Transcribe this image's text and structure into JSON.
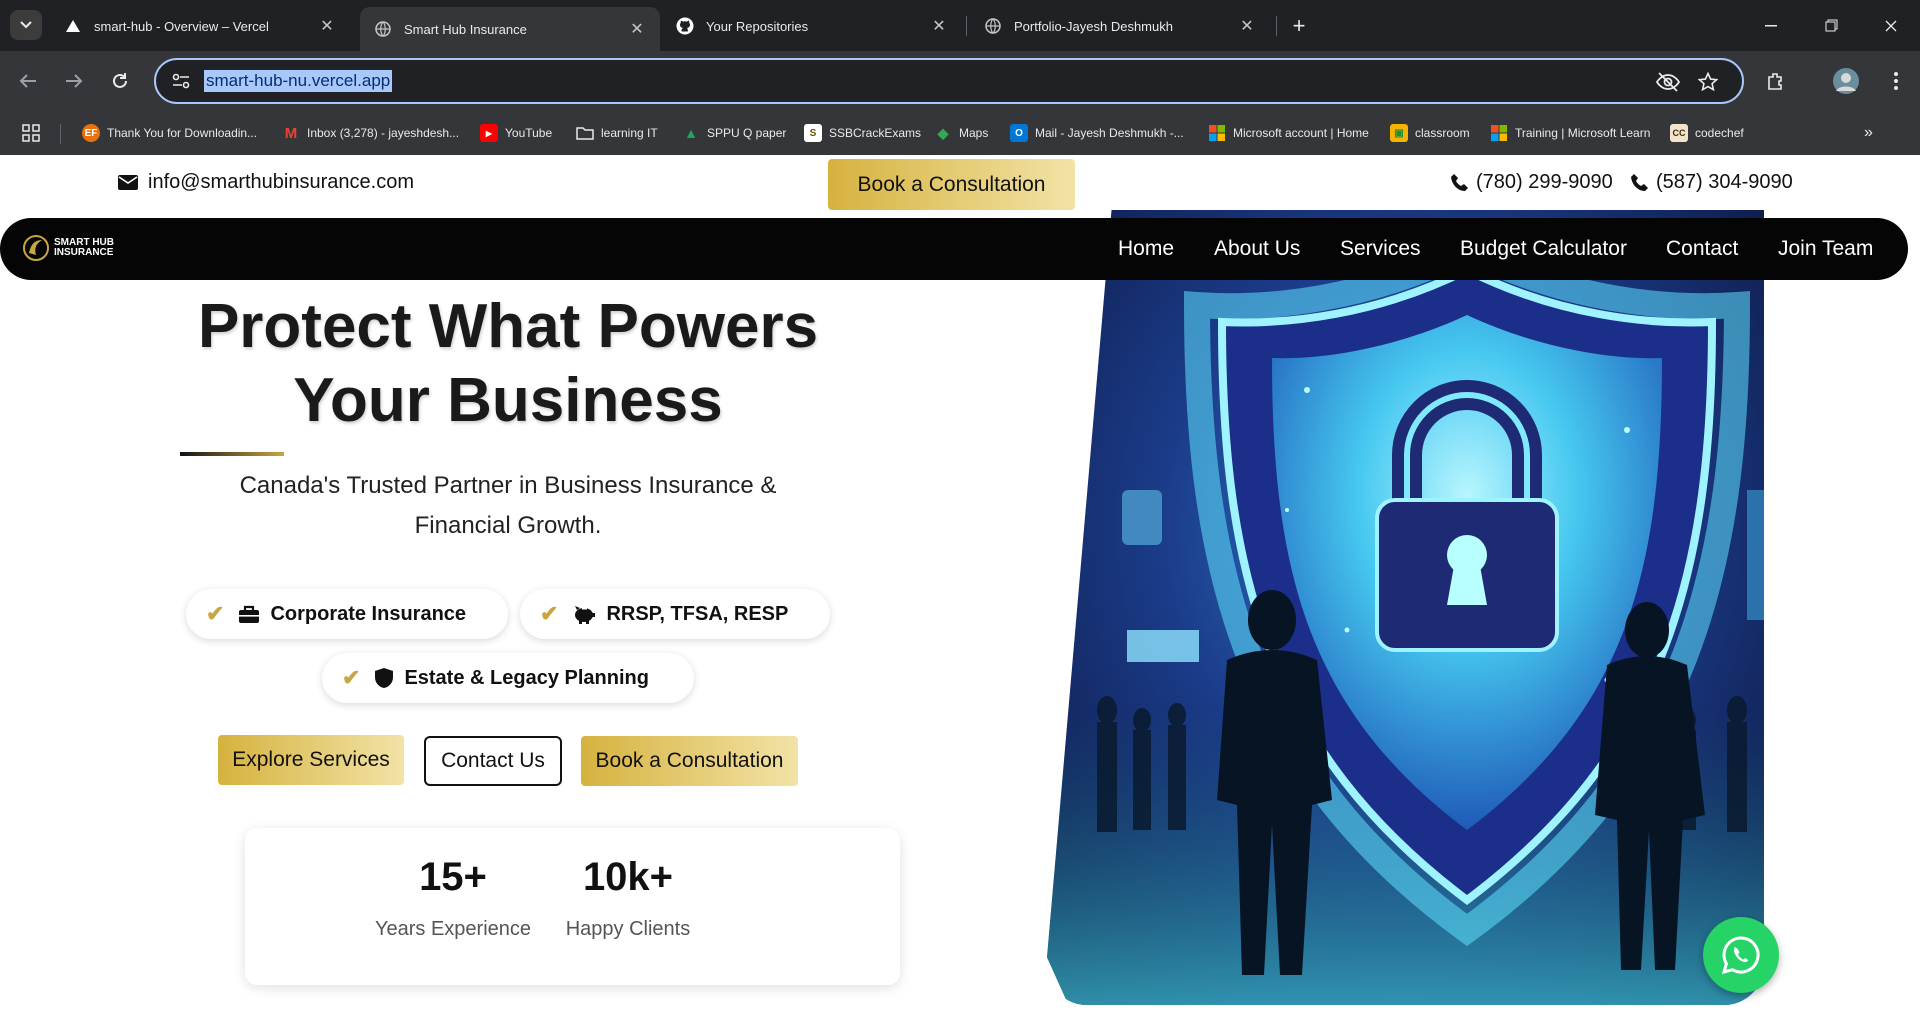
{
  "browser": {
    "tabs": [
      {
        "title": "smart-hub - Overview – Vercel",
        "icon": "vercel-icon"
      },
      {
        "title": "Smart Hub Insurance",
        "icon": "globe-icon"
      },
      {
        "title": "Your Repositories",
        "icon": "github-icon"
      },
      {
        "title": "Portfolio-Jayesh Deshmukh",
        "icon": "globe-icon"
      }
    ],
    "url": "smart-hub-nu.vercel.app",
    "bookmarks": [
      {
        "label": "Thank You for Downloadin...",
        "icon": "EF",
        "color": "#e8710a"
      },
      {
        "label": "Inbox (3,278) - jayeshdesh...",
        "icon": "M",
        "color": "#ea4335"
      },
      {
        "label": "YouTube",
        "icon": "▶",
        "color": "#ff0000"
      },
      {
        "label": "learning IT",
        "icon": "folder",
        "color": "#35363a"
      },
      {
        "label": "SPPU Q paper",
        "icon": "▲",
        "color": "#1fa463"
      },
      {
        "label": "SSBCrackExams",
        "icon": "S",
        "color": "#c89b3c"
      },
      {
        "label": "Maps",
        "icon": "◆",
        "color": "#34a853"
      },
      {
        "label": "Mail - Jayesh Deshmukh -...",
        "icon": "O",
        "color": "#0078d4"
      },
      {
        "label": "Microsoft account | Home",
        "icon": "ms",
        "color": "#f25022"
      },
      {
        "label": "classroom",
        "icon": "▣",
        "color": "#f4b400"
      },
      {
        "label": "Training | Microsoft Learn",
        "icon": "ms",
        "color": "#f25022"
      },
      {
        "label": "codechef",
        "icon": "CC",
        "color": "#5b4638"
      }
    ]
  },
  "topbar": {
    "email": "info@smarthubinsurance.com",
    "consult_label": "Book a Consultation",
    "phone1": "(780) 299-9090",
    "phone2": "(587) 304-9090"
  },
  "nav": {
    "logo_line1": "SMART HUB",
    "logo_line2": "INSURANCE",
    "links": [
      "Home",
      "About Us",
      "Services",
      "Budget Calculator",
      "Contact",
      "Join Team"
    ]
  },
  "hero": {
    "title_line1": "Protect What Powers",
    "title_line2": "Your Business",
    "subtitle": "Canada's Trusted Partner in Business Insurance & Financial Growth.",
    "features": [
      {
        "label": "Corporate Insurance",
        "icon": "briefcase-icon"
      },
      {
        "label": "RRSP, TFSA, RESP",
        "icon": "piggy-bank-icon"
      },
      {
        "label": "Estate & Legacy Planning",
        "icon": "shield-icon"
      }
    ],
    "buttons": {
      "explore": "Explore Services",
      "contact": "Contact Us",
      "consult": "Book a Consultation"
    }
  },
  "stats": [
    {
      "value": "15+",
      "label": "Years Experience"
    },
    {
      "value": "10k+",
      "label": "Happy Clients"
    }
  ],
  "colors": {
    "gold": "#d6b23f",
    "nav_bg": "#050505",
    "whatsapp": "#25d366"
  }
}
